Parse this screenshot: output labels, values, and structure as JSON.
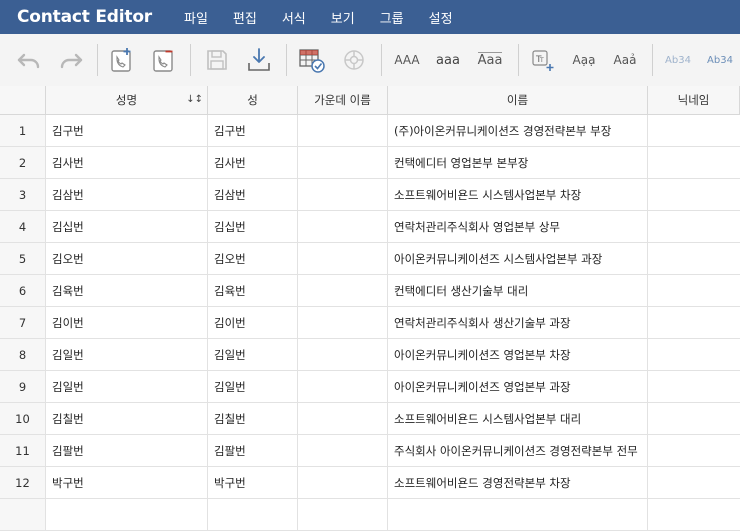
{
  "app": {
    "title": "Contact Editor"
  },
  "menu": [
    {
      "label": "파일"
    },
    {
      "label": "편집"
    },
    {
      "label": "서식"
    },
    {
      "label": "보기"
    },
    {
      "label": "그룹"
    },
    {
      "label": "설정"
    }
  ],
  "toolbar": {
    "uppercase_label": "AAA",
    "lowercase_label": "aaa",
    "titlecase_label": "Aaa",
    "fontsize1_label": "Ab34",
    "fontsize2_label": "Ab34"
  },
  "columns": [
    "성명",
    "성",
    "가운데 이름",
    "이름",
    "닉네임"
  ],
  "rows": [
    {
      "num": "1",
      "fullname": "김구번",
      "last": "김구번",
      "middle": "",
      "first": "(주)아이온커뮤니케이션즈 경영전략본부 부장",
      "nick": ""
    },
    {
      "num": "2",
      "fullname": "김사번",
      "last": "김사번",
      "middle": "",
      "first": "컨택에디터 영업본부 본부장",
      "nick": ""
    },
    {
      "num": "3",
      "fullname": "김삼번",
      "last": "김삼번",
      "middle": "",
      "first": "소프트웨어비욘드 시스템사업본부 차장",
      "nick": ""
    },
    {
      "num": "4",
      "fullname": "김십번",
      "last": "김십번",
      "middle": "",
      "first": "연락처관리주식회사 영업본부 상무",
      "nick": ""
    },
    {
      "num": "5",
      "fullname": "김오번",
      "last": "김오번",
      "middle": "",
      "first": "아이온커뮤니케이션즈 시스템사업본부 과장",
      "nick": ""
    },
    {
      "num": "6",
      "fullname": "김육번",
      "last": "김육번",
      "middle": "",
      "first": "컨택에디터 생산기술부 대리",
      "nick": ""
    },
    {
      "num": "7",
      "fullname": "김이번",
      "last": "김이번",
      "middle": "",
      "first": "연락처관리주식회사 생산기술부 과장",
      "nick": ""
    },
    {
      "num": "8",
      "fullname": "김일번",
      "last": "김일번",
      "middle": "",
      "first": "아이온커뮤니케이션즈 영업본부 차장",
      "nick": ""
    },
    {
      "num": "9",
      "fullname": "김일번",
      "last": "김일번",
      "middle": "",
      "first": "아이온커뮤니케이션즈 영업본부 과장",
      "nick": ""
    },
    {
      "num": "10",
      "fullname": "김칠번",
      "last": "김칠번",
      "middle": "",
      "first": "소프트웨어비욘드 시스템사업본부 대리",
      "nick": ""
    },
    {
      "num": "11",
      "fullname": "김팔번",
      "last": "김팔번",
      "middle": "",
      "first": "주식회사 아이온커뮤니케이션즈 경영전략본부 전무",
      "nick": ""
    },
    {
      "num": "12",
      "fullname": "박구번",
      "last": "박구번",
      "middle": "",
      "first": "소프트웨어비욘드 경영전략본부 차장",
      "nick": ""
    },
    {
      "num": "",
      "fullname": "",
      "last": "",
      "middle": "",
      "first": "",
      "nick": ""
    }
  ],
  "colors": {
    "titlebar": "#3b5f93",
    "toolbar": "#f4f4f4",
    "icon_blue": "#4a78b0",
    "icon_red": "#c0392b"
  }
}
